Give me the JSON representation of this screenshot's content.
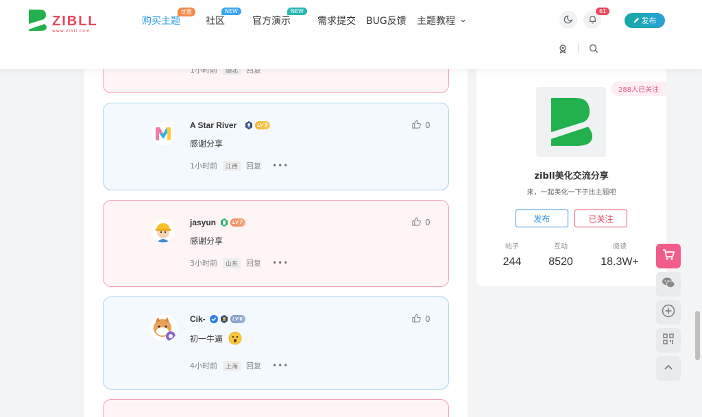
{
  "logo": {
    "text": "ZIBLL",
    "sub": "www.zibll.com",
    "color": "#e8485a",
    "mark_color": "#22b14c"
  },
  "nav": {
    "items": [
      {
        "label": "购买主题",
        "badge": "优惠",
        "active": true
      },
      {
        "label": "社区",
        "badge": "NEW"
      },
      {
        "label": "官方演示",
        "badge": "NEW"
      },
      {
        "label": "需求提交"
      },
      {
        "label": "BUG反馈"
      },
      {
        "label": "主题教程"
      }
    ]
  },
  "header": {
    "notification_count": "61",
    "publish_label": "发布"
  },
  "comments": [
    {
      "meta_time": "1小时前",
      "meta_location": "湖北",
      "reply": "回复",
      "variant": "pink"
    },
    {
      "name": "A Star River",
      "level": "LV 3",
      "text": "感谢分享",
      "time": "1小时前",
      "location": "江西",
      "reply": "回复",
      "likes": "0",
      "variant": "blue"
    },
    {
      "name": "jasyun",
      "level": "LV 7",
      "text": "感谢分享",
      "time": "3小时前",
      "location": "山东",
      "reply": "回复",
      "likes": "0",
      "variant": "pink"
    },
    {
      "name": "Cik-",
      "level": "LV 6",
      "text": "初一牛逼",
      "time": "4小时前",
      "location": "上海",
      "reply": "回复",
      "likes": "0",
      "variant": "blue"
    }
  ],
  "sidebar": {
    "follow_count": "288人已关注",
    "title": "zibll美化交流分享",
    "desc": "来，一起美化一下子比主题吧",
    "publish_button": "发布",
    "followed_button": "已关注",
    "stats": [
      {
        "label": "帖子",
        "value": "244"
      },
      {
        "label": "互动",
        "value": "8520"
      },
      {
        "label": "阅读",
        "value": "18.3W+"
      }
    ]
  },
  "colors": {
    "accent_blue": "#2e9fe6",
    "pink": "#e8485a",
    "teal": "#17a9a2"
  }
}
